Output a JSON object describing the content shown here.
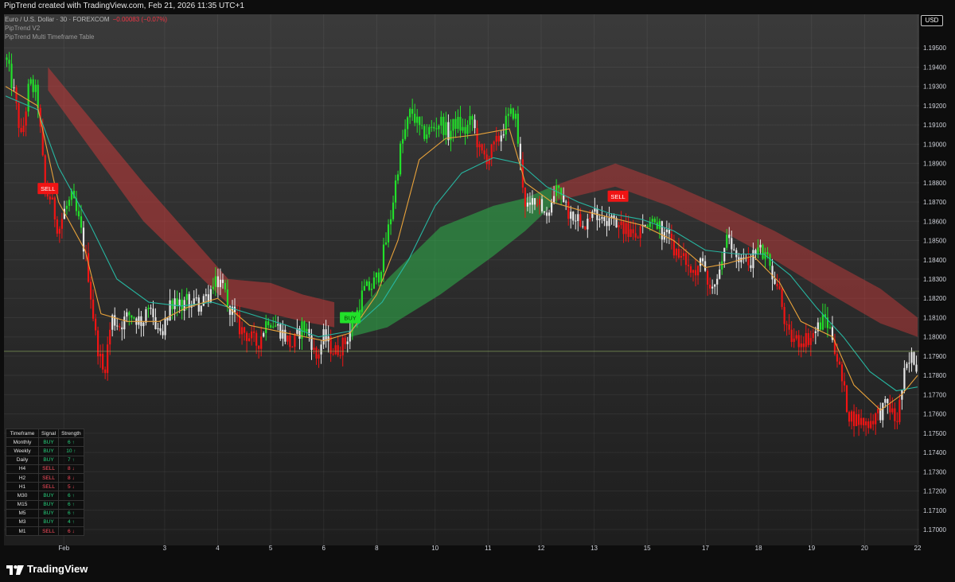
{
  "header": {
    "text": "PipTrend created with TradingView.com, Feb 21, 2026 11:35 UTC+1"
  },
  "legend": {
    "symbol": "Euro / U.S. Dollar · 30 · FOREXCOM",
    "change": "−0.00083 (−0.07%)",
    "indicator1": "PipTrend V2",
    "indicator2": "PipTrend Multi Timeframe Table"
  },
  "currency": "USD",
  "footer": {
    "brand": "TradingView"
  },
  "mtf_table": {
    "headers": [
      "Timeframe",
      "Signal",
      "Strength"
    ],
    "rows": [
      {
        "tf": "Monthly",
        "signal": "BUY",
        "strength": "6 ↑"
      },
      {
        "tf": "Weekly",
        "signal": "BUY",
        "strength": "10 ↑"
      },
      {
        "tf": "Daily",
        "signal": "BUY",
        "strength": "7 ↑"
      },
      {
        "tf": "H4",
        "signal": "SELL",
        "strength": "8 ↓"
      },
      {
        "tf": "H2",
        "signal": "SELL",
        "strength": "8 ↓"
      },
      {
        "tf": "H1",
        "signal": "SELL",
        "strength": "5 ↓"
      },
      {
        "tf": "M30",
        "signal": "BUY",
        "strength": "6 ↑"
      },
      {
        "tf": "M15",
        "signal": "BUY",
        "strength": "6 ↑"
      },
      {
        "tf": "M5",
        "signal": "BUY",
        "strength": "6 ↑"
      },
      {
        "tf": "M3",
        "signal": "BUY",
        "strength": "4 ↑"
      },
      {
        "tf": "M1",
        "signal": "SELL",
        "strength": "6 ↓"
      }
    ]
  },
  "colors": {
    "bull": "#22e02a",
    "bear": "#f01414",
    "neutral": "#e8e8e8",
    "fast_ma": "#e8a23a",
    "slow_ma": "#27b5a0",
    "cloud_bear": "#c23a3a",
    "cloud_bull": "#2fa84a",
    "buy_label": "#22e02a",
    "sell_label": "#f01414"
  },
  "chart_data": {
    "type": "line",
    "title": "Euro / U.S. Dollar · 30 · FOREXCOM",
    "ylim": [
      1.17,
      1.196
    ],
    "y_ticks": [
      "1.19500",
      "1.19400",
      "1.19300",
      "1.19200",
      "1.19100",
      "1.19000",
      "1.18900",
      "1.18800",
      "1.18700",
      "1.18600",
      "1.18500",
      "1.18400",
      "1.18300",
      "1.18200",
      "1.18100",
      "1.18000",
      "1.17900",
      "1.17800",
      "1.17700",
      "1.17600",
      "1.17500",
      "1.17400",
      "1.17300",
      "1.17200",
      "1.17100",
      "1.17000"
    ],
    "x_ticks": [
      {
        "label": "Feb",
        "day": 1.1
      },
      {
        "label": "3",
        "day": 3
      },
      {
        "label": "4",
        "day": 4
      },
      {
        "label": "5",
        "day": 5
      },
      {
        "label": "6",
        "day": 6
      },
      {
        "label": "8",
        "day": 7
      },
      {
        "label": "10",
        "day": 8.1
      },
      {
        "label": "11",
        "day": 9.1
      },
      {
        "label": "12",
        "day": 10.1
      },
      {
        "label": "13",
        "day": 11.1
      },
      {
        "label": "15",
        "day": 12.1
      },
      {
        "label": "17",
        "day": 13.2
      },
      {
        "label": "18",
        "day": 14.2
      },
      {
        "label": "19",
        "day": 15.2
      },
      {
        "label": "20",
        "day": 16.2
      },
      {
        "label": "22",
        "day": 17.2
      }
    ],
    "x_range": [
      0,
      17.2
    ],
    "grid": true,
    "price_points": [
      [
        0,
        1.1945
      ],
      [
        0.15,
        1.1928
      ],
      [
        0.3,
        1.1902
      ],
      [
        0.45,
        1.1932
      ],
      [
        0.6,
        1.1925
      ],
      [
        0.75,
        1.1875
      ],
      [
        0.85,
        1.1872
      ],
      [
        1.0,
        1.1855
      ],
      [
        1.1,
        1.1865
      ],
      [
        1.25,
        1.1872
      ],
      [
        1.4,
        1.1858
      ],
      [
        1.55,
        1.1835
      ],
      [
        1.7,
        1.18
      ],
      [
        1.85,
        1.178
      ],
      [
        2.0,
        1.181
      ],
      [
        2.15,
        1.1806
      ],
      [
        2.35,
        1.1812
      ],
      [
        2.55,
        1.1808
      ],
      [
        2.75,
        1.1812
      ],
      [
        2.95,
        1.18
      ],
      [
        3.1,
        1.1815
      ],
      [
        3.3,
        1.1817
      ],
      [
        3.5,
        1.1819
      ],
      [
        3.7,
        1.1816
      ],
      [
        3.9,
        1.1825
      ],
      [
        4.05,
        1.183
      ],
      [
        4.2,
        1.1818
      ],
      [
        4.4,
        1.1805
      ],
      [
        4.6,
        1.18
      ],
      [
        4.75,
        1.1796
      ],
      [
        4.95,
        1.181
      ],
      [
        5.2,
        1.1803
      ],
      [
        5.4,
        1.1795
      ],
      [
        5.6,
        1.1806
      ],
      [
        5.75,
        1.18
      ],
      [
        5.85,
        1.1788
      ],
      [
        6.0,
        1.18
      ],
      [
        6.2,
        1.1792
      ],
      [
        6.4,
        1.1797
      ],
      [
        6.6,
        1.181
      ],
      [
        6.75,
        1.1824
      ],
      [
        6.9,
        1.1826
      ],
      [
        7.05,
        1.1833
      ],
      [
        7.25,
        1.186
      ],
      [
        7.45,
        1.1898
      ],
      [
        7.65,
        1.1918
      ],
      [
        7.85,
        1.1905
      ],
      [
        8.05,
        1.1908
      ],
      [
        8.2,
        1.1912
      ],
      [
        8.35,
        1.1905
      ],
      [
        8.5,
        1.1912
      ],
      [
        8.65,
        1.1906
      ],
      [
        8.8,
        1.1913
      ],
      [
        8.95,
        1.1895
      ],
      [
        9.1,
        1.1893
      ],
      [
        9.25,
        1.19
      ],
      [
        9.45,
        1.1912
      ],
      [
        9.6,
        1.1918
      ],
      [
        9.7,
        1.1892
      ],
      [
        9.8,
        1.187
      ],
      [
        9.9,
        1.1865
      ],
      [
        10.0,
        1.1875
      ],
      [
        10.15,
        1.1862
      ],
      [
        10.3,
        1.187
      ],
      [
        10.45,
        1.1878
      ],
      [
        10.6,
        1.1865
      ],
      [
        10.75,
        1.1863
      ],
      [
        10.95,
        1.186
      ],
      [
        11.15,
        1.1865
      ],
      [
        11.3,
        1.1862
      ],
      [
        11.5,
        1.186
      ],
      [
        11.7,
        1.1855
      ],
      [
        11.9,
        1.1852
      ],
      [
        12.1,
        1.186
      ],
      [
        12.3,
        1.1858
      ],
      [
        12.5,
        1.185
      ],
      [
        12.7,
        1.1843
      ],
      [
        12.95,
        1.1833
      ],
      [
        13.15,
        1.1838
      ],
      [
        13.35,
        1.1823
      ],
      [
        13.6,
        1.185
      ],
      [
        13.8,
        1.1842
      ],
      [
        14.0,
        1.1838
      ],
      [
        14.2,
        1.1846
      ],
      [
        14.4,
        1.1838
      ],
      [
        14.6,
        1.1822
      ],
      [
        14.75,
        1.18
      ],
      [
        14.95,
        1.1798
      ],
      [
        15.2,
        1.18
      ],
      [
        15.45,
        1.181
      ],
      [
        15.6,
        1.18
      ],
      [
        15.75,
        1.178
      ],
      [
        15.9,
        1.176
      ],
      [
        16.05,
        1.1757
      ],
      [
        16.25,
        1.1755
      ],
      [
        16.45,
        1.176
      ],
      [
        16.65,
        1.1765
      ],
      [
        16.8,
        1.1755
      ],
      [
        16.95,
        1.178
      ],
      [
        17.1,
        1.179
      ],
      [
        17.2,
        1.1785
      ]
    ],
    "fast_ma": [
      [
        0,
        1.193
      ],
      [
        0.6,
        1.192
      ],
      [
        1.0,
        1.187
      ],
      [
        1.5,
        1.1845
      ],
      [
        1.8,
        1.1812
      ],
      [
        2.3,
        1.1808
      ],
      [
        2.9,
        1.1808
      ],
      [
        3.4,
        1.1815
      ],
      [
        4.0,
        1.182
      ],
      [
        4.6,
        1.1806
      ],
      [
        5.3,
        1.1802
      ],
      [
        6.0,
        1.1798
      ],
      [
        6.5,
        1.1802
      ],
      [
        7.0,
        1.1822
      ],
      [
        7.4,
        1.185
      ],
      [
        7.8,
        1.1892
      ],
      [
        8.3,
        1.1903
      ],
      [
        8.9,
        1.1905
      ],
      [
        9.5,
        1.1908
      ],
      [
        9.8,
        1.188
      ],
      [
        10.3,
        1.187
      ],
      [
        10.8,
        1.1866
      ],
      [
        11.4,
        1.1862
      ],
      [
        12.0,
        1.1858
      ],
      [
        12.6,
        1.185
      ],
      [
        13.2,
        1.1836
      ],
      [
        13.6,
        1.1838
      ],
      [
        14.1,
        1.1842
      ],
      [
        14.6,
        1.1828
      ],
      [
        15.0,
        1.1808
      ],
      [
        15.6,
        1.18
      ],
      [
        16.0,
        1.1775
      ],
      [
        16.5,
        1.1762
      ],
      [
        16.9,
        1.177
      ],
      [
        17.2,
        1.178
      ]
    ],
    "slow_ma": [
      [
        0,
        1.1925
      ],
      [
        0.6,
        1.1918
      ],
      [
        1.0,
        1.1888
      ],
      [
        1.6,
        1.1858
      ],
      [
        2.1,
        1.183
      ],
      [
        2.7,
        1.1818
      ],
      [
        3.3,
        1.1816
      ],
      [
        3.9,
        1.1818
      ],
      [
        4.6,
        1.1812
      ],
      [
        5.3,
        1.1806
      ],
      [
        5.9,
        1.18
      ],
      [
        6.5,
        1.1803
      ],
      [
        7.1,
        1.1818
      ],
      [
        7.6,
        1.184
      ],
      [
        8.1,
        1.1868
      ],
      [
        8.6,
        1.1885
      ],
      [
        9.2,
        1.1893
      ],
      [
        9.7,
        1.189
      ],
      [
        10.2,
        1.1878
      ],
      [
        10.8,
        1.187
      ],
      [
        11.4,
        1.1864
      ],
      [
        12.0,
        1.1861
      ],
      [
        12.6,
        1.1855
      ],
      [
        13.2,
        1.1845
      ],
      [
        13.8,
        1.1843
      ],
      [
        14.3,
        1.1843
      ],
      [
        14.8,
        1.1832
      ],
      [
        15.3,
        1.1815
      ],
      [
        15.8,
        1.18
      ],
      [
        16.3,
        1.1782
      ],
      [
        16.8,
        1.1772
      ],
      [
        17.2,
        1.1774
      ]
    ],
    "cloud_bear": {
      "upper": [
        [
          0.8,
          1.194
        ],
        [
          2.6,
          1.188
        ],
        [
          4.2,
          1.183
        ],
        [
          5.0,
          1.1828
        ],
        [
          5.6,
          1.1822
        ],
        [
          6.2,
          1.1818
        ]
      ],
      "lower": [
        [
          0.8,
          1.1928
        ],
        [
          2.6,
          1.186
        ],
        [
          4.2,
          1.1817
        ],
        [
          5.0,
          1.1812
        ],
        [
          5.6,
          1.1808
        ],
        [
          6.2,
          1.1805
        ]
      ]
    },
    "cloud_bull": {
      "upper": [
        [
          6.5,
          1.1808
        ],
        [
          7.2,
          1.183
        ],
        [
          8.2,
          1.1857
        ],
        [
          9.2,
          1.1868
        ],
        [
          9.8,
          1.1872
        ],
        [
          10.3,
          1.1878
        ]
      ],
      "lower": [
        [
          6.5,
          1.18
        ],
        [
          7.2,
          1.1805
        ],
        [
          8.2,
          1.1822
        ],
        [
          9.2,
          1.1842
        ],
        [
          9.8,
          1.1855
        ],
        [
          10.3,
          1.1868
        ]
      ]
    },
    "cloud_bear2": {
      "upper": [
        [
          10.3,
          1.1878
        ],
        [
          11.5,
          1.189
        ],
        [
          12.5,
          1.188
        ],
        [
          13.5,
          1.1868
        ],
        [
          14.5,
          1.1855
        ],
        [
          15.5,
          1.184
        ],
        [
          16.5,
          1.1825
        ],
        [
          17.2,
          1.181
        ]
      ],
      "lower": [
        [
          10.3,
          1.187
        ],
        [
          11.5,
          1.1878
        ],
        [
          12.5,
          1.1868
        ],
        [
          13.5,
          1.1855
        ],
        [
          14.5,
          1.184
        ],
        [
          15.5,
          1.1823
        ],
        [
          16.5,
          1.1807
        ],
        [
          17.2,
          1.18
        ]
      ]
    },
    "last_price": 1.17925,
    "signals": [
      {
        "label": "SELL",
        "day": 0.8,
        "price": 1.1877
      },
      {
        "label": "BUY",
        "day": 6.5,
        "price": 1.181
      },
      {
        "label": "SELL",
        "day": 11.55,
        "price": 1.1873
      }
    ]
  }
}
